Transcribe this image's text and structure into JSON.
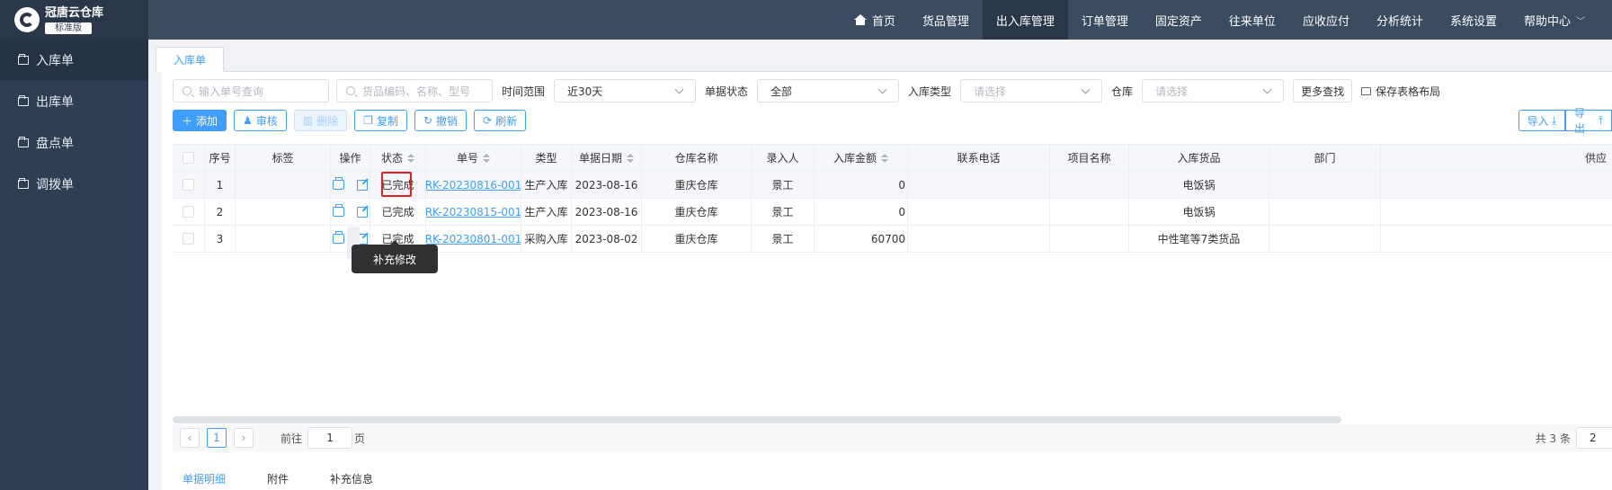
{
  "app": {
    "title": "冠唐云仓库",
    "edition": "标准版"
  },
  "sidebar": {
    "items": [
      {
        "label": "入库单",
        "active": true
      },
      {
        "label": "出库单"
      },
      {
        "label": "盘点单"
      },
      {
        "label": "调拨单"
      }
    ]
  },
  "topnav": {
    "items": [
      {
        "label": "首页"
      },
      {
        "label": "货品管理"
      },
      {
        "label": "出入库管理",
        "active": true
      },
      {
        "label": "订单管理"
      },
      {
        "label": "固定资产"
      },
      {
        "label": "往来单位"
      },
      {
        "label": "应收应付"
      },
      {
        "label": "分析统计"
      },
      {
        "label": "系统设置"
      },
      {
        "label": "帮助中心"
      }
    ]
  },
  "tabs": {
    "current": "入库单"
  },
  "filters": {
    "order_no_placeholder": "输入单号查询",
    "goods_placeholder": "货品编码、名称、型号",
    "time_range_label": "时间范围",
    "time_range_value": "近30天",
    "status_label": "单据状态",
    "status_value": "全部",
    "type_label": "入库类型",
    "type_placeholder": "请选择",
    "warehouse_label": "仓库",
    "warehouse_placeholder": "请选择",
    "more_search": "更多查找",
    "save_layout": "保存表格布局"
  },
  "toolbar": {
    "add": "添加",
    "audit": "审核",
    "delete": "删除",
    "copy": "复制",
    "revoke": "撤销",
    "refresh": "刷新",
    "import": "导入",
    "export": "导出"
  },
  "table": {
    "headers": {
      "index": "序号",
      "tag": "标签",
      "ops": "操作",
      "status": "状态",
      "no": "单号",
      "type": "类型",
      "date": "单据日期",
      "warehouse": "仓库名称",
      "entry": "录入人",
      "amount": "入库金额",
      "phone": "联系电话",
      "project": "项目名称",
      "goods": "入库货品",
      "dept": "部门",
      "supplier": "供应"
    },
    "rows": [
      {
        "index": "1",
        "status": "已完成",
        "no": "RK-20230816-001",
        "type": "生产入库",
        "date": "2023-08-16",
        "warehouse": "重庆仓库",
        "entry": "景工",
        "amount": "0",
        "goods": "电饭锅"
      },
      {
        "index": "2",
        "status": "已完成",
        "no": "RK-20230815-001",
        "type": "生产入库",
        "date": "2023-08-16",
        "warehouse": "重庆仓库",
        "entry": "景工",
        "amount": "0",
        "goods": "电饭锅"
      },
      {
        "index": "3",
        "status": "已完成",
        "no": "RK-20230801-001",
        "type": "采购入库",
        "date": "2023-08-02",
        "warehouse": "重庆仓库",
        "entry": "景工",
        "amount": "60700",
        "goods": "中性笔等7类货品"
      }
    ]
  },
  "tooltip": {
    "text": "补充修改"
  },
  "pager": {
    "current": "1",
    "goto_label": "前往",
    "goto_value": "1",
    "page_unit": "页",
    "total": "共 3 条",
    "size": "2"
  },
  "bottom_tabs": [
    {
      "label": "单据明细",
      "active": true
    },
    {
      "label": "附件"
    },
    {
      "label": "补充信息"
    }
  ]
}
